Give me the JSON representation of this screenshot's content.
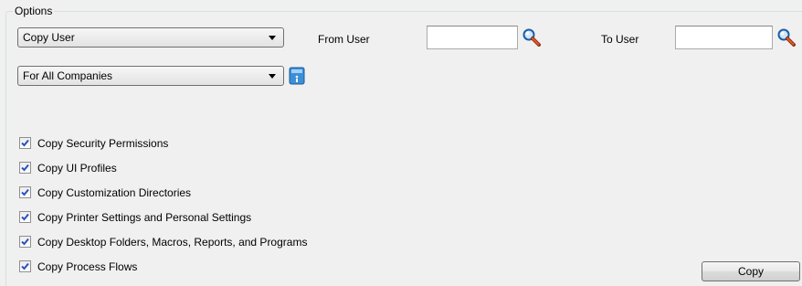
{
  "options": {
    "group_title": "Options",
    "copy_mode": "Copy User",
    "from_user_label": "From User",
    "from_user_value": "",
    "to_user_label": "To User",
    "to_user_value": "",
    "company_scope": "For All Companies"
  },
  "checkboxes": [
    {
      "label": "Copy Security Permissions",
      "checked": true
    },
    {
      "label": "Copy UI Profiles",
      "checked": true
    },
    {
      "label": "Copy Customization Directories",
      "checked": true
    },
    {
      "label": "Copy Printer Settings and Personal Settings",
      "checked": true
    },
    {
      "label": "Copy Desktop Folders, Macros, Reports, and Programs",
      "checked": true
    },
    {
      "label": "Copy Process Flows",
      "checked": true
    }
  ],
  "actions": {
    "copy_label": "Copy"
  },
  "icons": {
    "search": "magnifier-icon",
    "info": "info-icon"
  }
}
